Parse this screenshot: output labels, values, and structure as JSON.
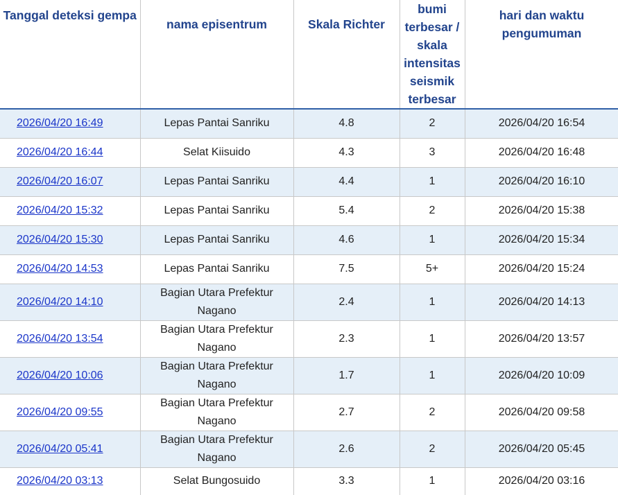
{
  "table": {
    "headers": {
      "date": "Tanggal deteksi gempa",
      "name": "nama episentrum",
      "magnitude": "Skala Richter",
      "intensity": "bumi terbesar / skala intensitas seismik terbesar",
      "announce": "hari dan waktu pengumuman"
    },
    "rows": [
      {
        "date": "2026/04/20 16:49",
        "name": "Lepas Pantai Sanriku",
        "magnitude": "4.8",
        "intensity": "2",
        "announce": "2026/04/20 16:54"
      },
      {
        "date": "2026/04/20 16:44",
        "name": "Selat Kiisuido",
        "magnitude": "4.3",
        "intensity": "3",
        "announce": "2026/04/20 16:48"
      },
      {
        "date": "2026/04/20 16:07",
        "name": "Lepas Pantai Sanriku",
        "magnitude": "4.4",
        "intensity": "1",
        "announce": "2026/04/20 16:10"
      },
      {
        "date": "2026/04/20 15:32",
        "name": "Lepas Pantai Sanriku",
        "magnitude": "5.4",
        "intensity": "2",
        "announce": "2026/04/20 15:38"
      },
      {
        "date": "2026/04/20 15:30",
        "name": "Lepas Pantai Sanriku",
        "magnitude": "4.6",
        "intensity": "1",
        "announce": "2026/04/20 15:34"
      },
      {
        "date": "2026/04/20 14:53",
        "name": "Lepas Pantai Sanriku",
        "magnitude": "7.5",
        "intensity": "5+",
        "announce": "2026/04/20 15:24"
      },
      {
        "date": "2026/04/20 14:10",
        "name": "Bagian Utara Prefektur Nagano",
        "magnitude": "2.4",
        "intensity": "1",
        "announce": "2026/04/20 14:13"
      },
      {
        "date": "2026/04/20 13:54",
        "name": "Bagian Utara Prefektur Nagano",
        "magnitude": "2.3",
        "intensity": "1",
        "announce": "2026/04/20 13:57"
      },
      {
        "date": "2026/04/20 10:06",
        "name": "Bagian Utara Prefektur Nagano",
        "magnitude": "1.7",
        "intensity": "1",
        "announce": "2026/04/20 10:09"
      },
      {
        "date": "2026/04/20 09:55",
        "name": "Bagian Utara Prefektur Nagano",
        "magnitude": "2.7",
        "intensity": "2",
        "announce": "2026/04/20 09:58"
      },
      {
        "date": "2026/04/20 05:41",
        "name": "Bagian Utara Prefektur Nagano",
        "magnitude": "2.6",
        "intensity": "2",
        "announce": "2026/04/20 05:45"
      },
      {
        "date": "2026/04/20 03:13",
        "name": "Selat Bungosuido",
        "magnitude": "3.3",
        "intensity": "1",
        "announce": "2026/04/20 03:16"
      }
    ]
  }
}
